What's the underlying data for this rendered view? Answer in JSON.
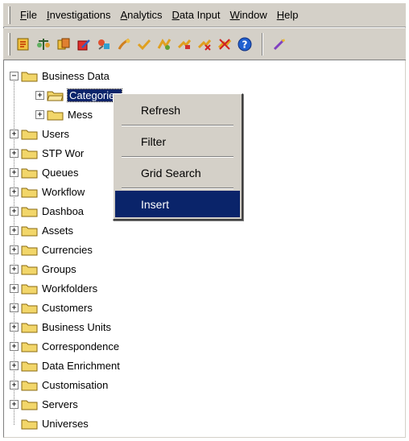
{
  "menubar": {
    "items": [
      {
        "label": "File"
      },
      {
        "label": "Investigations"
      },
      {
        "label": "Analytics"
      },
      {
        "label": "Data Input"
      },
      {
        "label": "Window"
      },
      {
        "label": "Help"
      }
    ]
  },
  "toolbar": {
    "buttons": [
      {
        "icon": "open-icon"
      },
      {
        "icon": "balance-icon"
      },
      {
        "icon": "copy-icon"
      },
      {
        "icon": "edit-icon"
      },
      {
        "icon": "tools-icon"
      },
      {
        "icon": "key-icon"
      },
      {
        "icon": "check-icon"
      },
      {
        "icon": "user-icon"
      },
      {
        "icon": "flag-icon"
      },
      {
        "icon": "cross-icon"
      },
      {
        "icon": "cross-flag-icon"
      },
      {
        "icon": "help-icon"
      },
      {
        "icon": "wand-icon"
      }
    ]
  },
  "tree": {
    "root": {
      "label": "Business Data",
      "expander": "−"
    },
    "children": [
      {
        "label": "Categories",
        "expander": "+",
        "selected": true
      },
      {
        "label": "Mess",
        "expander": "+"
      }
    ],
    "items": [
      {
        "label": "Users",
        "expander": "+"
      },
      {
        "label": "STP Wor",
        "expander": "+"
      },
      {
        "label": "Queues",
        "expander": "+"
      },
      {
        "label": "Workflow",
        "expander": "+"
      },
      {
        "label": "Dashboa",
        "expander": "+"
      },
      {
        "label": "Assets",
        "expander": "+"
      },
      {
        "label": "Currencies",
        "expander": "+"
      },
      {
        "label": "Groups",
        "expander": "+"
      },
      {
        "label": "Workfolders",
        "expander": "+"
      },
      {
        "label": "Customers",
        "expander": "+"
      },
      {
        "label": "Business Units",
        "expander": "+"
      },
      {
        "label": "Correspondence",
        "expander": "+"
      },
      {
        "label": "Data Enrichment",
        "expander": "+"
      },
      {
        "label": "Customisation",
        "expander": "+"
      },
      {
        "label": "Servers",
        "expander": "+"
      },
      {
        "label": "Universes",
        "expander": ""
      }
    ]
  },
  "context_menu": {
    "items": [
      {
        "label": "Refresh"
      },
      {
        "label": "Filter"
      },
      {
        "label": "Grid Search"
      },
      {
        "label": "Insert",
        "active": true
      }
    ]
  },
  "colors": {
    "selection": "#0a246a",
    "chrome": "#d4d0c8",
    "folder": "#f2d66a"
  }
}
